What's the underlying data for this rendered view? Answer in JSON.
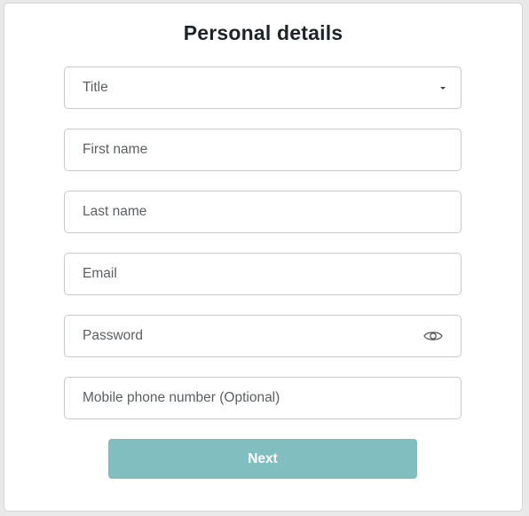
{
  "form": {
    "heading": "Personal details",
    "fields": [
      {
        "placeholder": "Title",
        "type": "select",
        "icon": "chevron-down-icon"
      },
      {
        "placeholder": "First name",
        "type": "text"
      },
      {
        "placeholder": "Last name",
        "type": "text"
      },
      {
        "placeholder": "Email",
        "type": "email"
      },
      {
        "placeholder": "Password",
        "type": "password",
        "icon": "eye-icon"
      },
      {
        "placeholder": "Mobile phone number (Optional)",
        "type": "tel"
      }
    ],
    "next_label": "Next"
  },
  "colors": {
    "button_bg": "#80bec0",
    "button_text": "#ffffff",
    "heading": "#1d2326",
    "border": "#c9c9c9"
  }
}
